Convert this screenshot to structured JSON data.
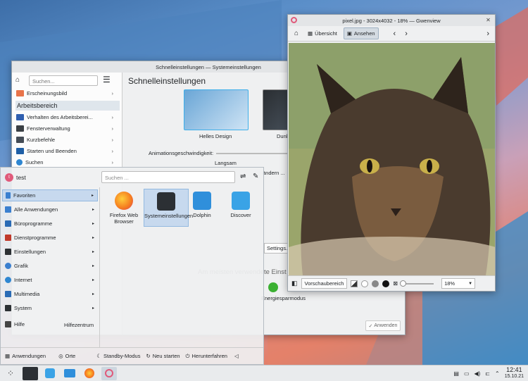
{
  "settings": {
    "title": "Schnelleinstellungen — Systemeinstellungen",
    "search_placeholder": "Suchen...",
    "heading": "Schnelleinstellungen",
    "side_items": [
      {
        "label": "Erscheinungsbild",
        "color": "#e8744a"
      },
      {
        "label": "Verhalten des Arbeitsberei...",
        "color": "#2f5fb0"
      },
      {
        "label": "Fensterverwaltung",
        "color": "#3a3f44"
      },
      {
        "label": "Kurzbefehle",
        "color": "#444c55"
      },
      {
        "label": "Starten und Beenden",
        "color": "#1f5fa6"
      },
      {
        "label": "Suchen",
        "color": "#2e86d1"
      }
    ],
    "section_label": "Arbeitsbereich",
    "theme_light": "Helles Design",
    "theme_dark": "Dunk",
    "anim_label": "Animationsgeschwindigkeit:",
    "anim_value": "Langsam",
    "change_btn": "ändern ...",
    "settings_btn": "Settings...",
    "most_used": "Am meisten verwendete Einst",
    "energy": "Energiesparmodus",
    "apply": "Anwenden"
  },
  "gwen": {
    "title": "pixel.jpg - 3024x4032 - 18% — Gwenview",
    "overview": "Übersicht",
    "view": "Ansehen",
    "preview": "Vorschaubereich",
    "zoom": "18%"
  },
  "launcher": {
    "user": "test",
    "search_placeholder": "Suchen ...",
    "categories": [
      "Favoriten",
      "Alle Anwendungen",
      "Büroprogramme",
      "Dienstprogramme",
      "Einstellungen",
      "Grafik",
      "Internet",
      "Multimedia",
      "System",
      "Hilfe"
    ],
    "help_center": "Hilfezentrum",
    "apps": [
      {
        "label": "Firefox Web Browser",
        "color": "#f57a1f"
      },
      {
        "label": "Systemeinstellungen",
        "color": "#2c3034"
      },
      {
        "label": "Dolphin",
        "color": "#2f8fdb"
      },
      {
        "label": "Discover",
        "color": "#3aa3e6"
      }
    ],
    "footer": {
      "apps": "Anwendungen",
      "places": "Orte",
      "standby": "Standby-Modus",
      "restart": "Neu starten",
      "shutdown": "Herunterfahren"
    }
  },
  "taskbar": {
    "time": "12:41",
    "date": "15.10.21"
  }
}
